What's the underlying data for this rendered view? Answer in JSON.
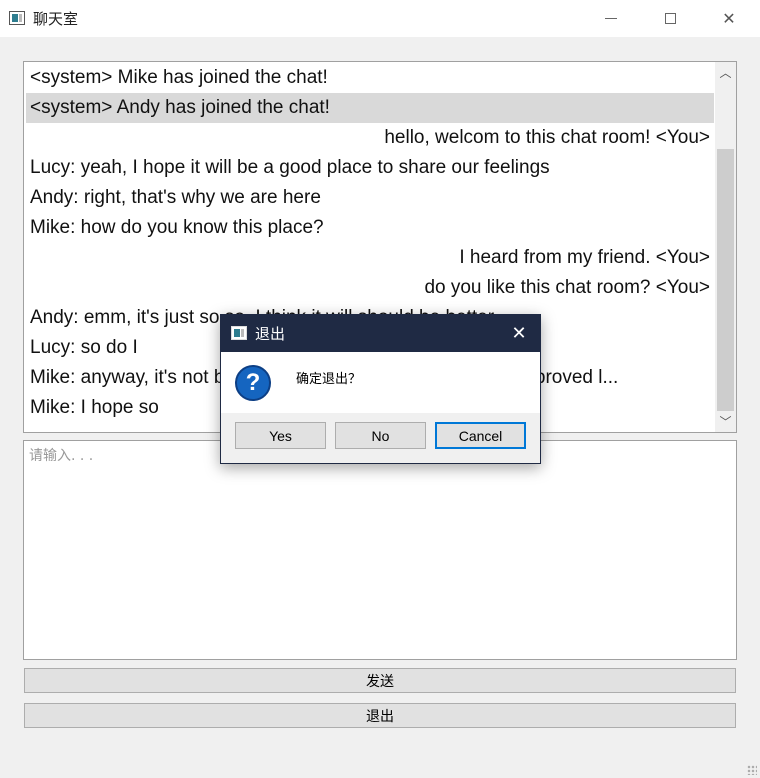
{
  "window": {
    "title": "聊天室",
    "minimize_glyph": "",
    "maximize_glyph": "",
    "close_glyph": "✕"
  },
  "chat": {
    "messages": [
      {
        "text": "<system> Mike has joined the chat!",
        "align": "left",
        "selected": false
      },
      {
        "text": "<system> Andy has joined the chat!",
        "align": "left",
        "selected": true
      },
      {
        "text": "hello, welcom to this chat room! <You>",
        "align": "right",
        "selected": false
      },
      {
        "text": "Lucy: yeah, I hope it will be a good place to share our feelings",
        "align": "left",
        "selected": false
      },
      {
        "text": "Andy: right, that's why we are here",
        "align": "left",
        "selected": false
      },
      {
        "text": "Mike: how do you know this place?",
        "align": "left",
        "selected": false
      },
      {
        "text": "I heard from my friend. <You>",
        "align": "right",
        "selected": false
      },
      {
        "text": "do you like this chat room? <You>",
        "align": "right",
        "selected": false
      },
      {
        "text": "Andy: emm, it's just so so. I think it will should be better",
        "align": "left",
        "selected": false
      },
      {
        "text": "Lucy: so do I",
        "align": "left",
        "selected": false
      },
      {
        "text": "Mike: anyway, it's not bad. I believe this chat room will be improved l...",
        "align": "left",
        "selected": false
      },
      {
        "text": "Mike: I hope so",
        "align": "left",
        "selected": false
      }
    ],
    "scroll_up_glyph": "︿",
    "scroll_down_glyph": "﹀"
  },
  "input": {
    "placeholder": "请输入. . .",
    "value": ""
  },
  "buttons": {
    "send": "发送",
    "quit": "退出"
  },
  "dialog": {
    "title": "退出",
    "close_glyph": "✕",
    "icon_glyph": "?",
    "message": "确定退出？",
    "yes": "Yes",
    "no": "No",
    "cancel": "Cancel"
  }
}
